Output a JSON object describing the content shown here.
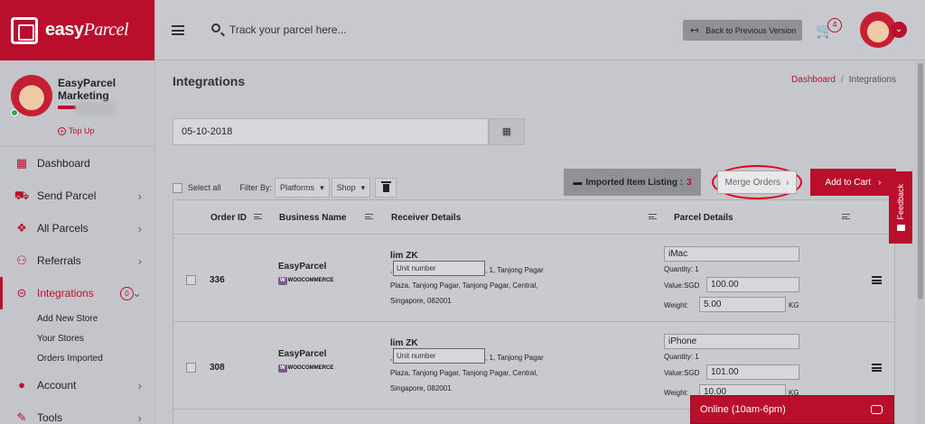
{
  "brand": {
    "name": "easy",
    "name_script": "Parcel"
  },
  "profile": {
    "name": "EasyParcel Marketing",
    "topup_label": "Top Up"
  },
  "sidebar": {
    "items": [
      {
        "label": "Dashboard",
        "icon": "dashboard-icon"
      },
      {
        "label": "Send Parcel",
        "icon": "truck-icon"
      },
      {
        "label": "All Parcels",
        "icon": "boxes-icon"
      },
      {
        "label": "Referrals",
        "icon": "users-plus-icon"
      },
      {
        "label": "Integrations",
        "icon": "link-icon",
        "badge": "0"
      },
      {
        "label": "Account",
        "icon": "person-icon"
      },
      {
        "label": "Tools",
        "icon": "wrench-icon"
      }
    ],
    "sub_items": [
      "Add New Store",
      "Your Stores",
      "Orders Imported"
    ]
  },
  "topbar": {
    "search_placeholder": "Track your parcel here...",
    "back_label": "Back to Previous Version",
    "cart_count": "4"
  },
  "page": {
    "title": "Integrations",
    "breadcrumb": [
      "Dashboard",
      "Integrations"
    ],
    "date_value": "05-10-2018"
  },
  "toolbar": {
    "select_all": "Select all",
    "filter_by": "Filter By:",
    "platforms": "Platforms",
    "shop": "Shop",
    "imported_label": "Imported Item Listing :",
    "imported_count": "3",
    "merge_label": "Merge Orders",
    "add_cart_label": "Add to Cart"
  },
  "table": {
    "headers": [
      "Order ID",
      "Business Name",
      "Receiver Details",
      "Parcel Details"
    ],
    "rows": [
      {
        "order_id": "336",
        "business": "EasyParcel",
        "platform": "WOOCOMMERCE",
        "receiver_name": "lim ZK",
        "unit_placeholder": "Unit number",
        "addr1": ", 1, Tanjong Pagar",
        "addr2": "Plaza, Tanjong Pagar, Tanjong Pagar, Central,",
        "addr3": "Singapore, 082001",
        "item": "iMac",
        "quantity": "Quantity: 1",
        "value_label": "Value:SGD",
        "value": "100.00",
        "weight_label": "Weight:",
        "weight": "5.00",
        "weight_unit": "KG"
      },
      {
        "order_id": "308",
        "business": "EasyParcel",
        "platform": "WOOCOMMERCE",
        "receiver_name": "lim ZK",
        "unit_placeholder": "Unit number",
        "addr1": ", 1, Tanjong Pagar",
        "addr2": "Plaza, Tanjong Pagar, Tanjong Pagar, Central,",
        "addr3": "Singapore, 082001",
        "item": "iPhone",
        "quantity": "Quantity: 1",
        "value_label": "Value:SGD",
        "value": "101.00",
        "weight_label": "Weight:",
        "weight": "10.00",
        "weight_unit": "KG"
      }
    ]
  },
  "feedback_label": "Feedback",
  "chat_label": "Online (10am-6pm)"
}
